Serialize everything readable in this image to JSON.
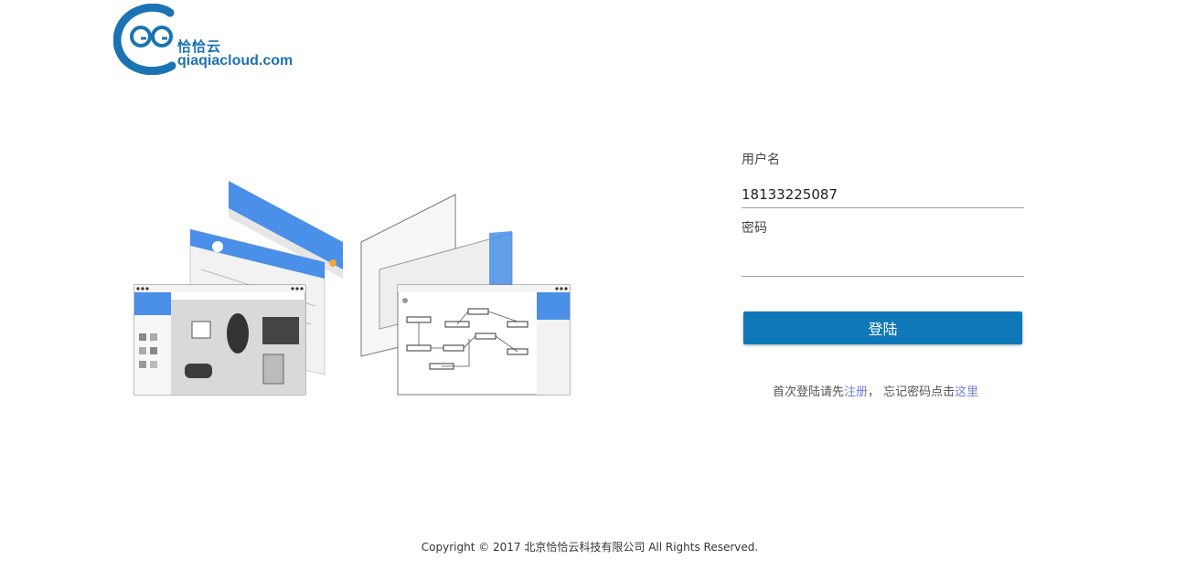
{
  "logo": {
    "cn_name": "恰恰云",
    "domain": "qiaqiacloud.com",
    "brand_color": "#1b73b3"
  },
  "form": {
    "username_label": "用户名",
    "username_value": "18133225087",
    "password_label": "密码",
    "password_value": "",
    "login_button": "登陆",
    "hint_prefix": "首次登陆请先",
    "register_link": "注册",
    "hint_middle": "， 忘记密码点击",
    "forgot_link": "这里"
  },
  "footer": {
    "copyright": "Copyright © 2017 北京恰恰云科技有限公司 All Rights Reserved."
  },
  "colors": {
    "button": "#0f78b8",
    "link": "#6f7fd6",
    "panel_header": "#4a8fe8"
  }
}
